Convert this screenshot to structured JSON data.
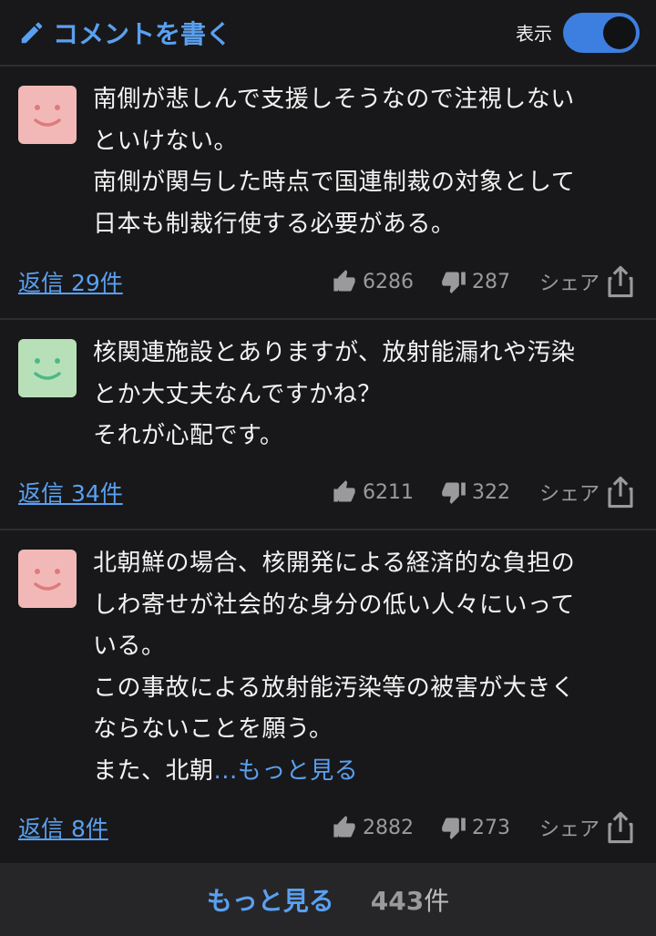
{
  "header": {
    "write_label": "コメントを書く",
    "toggle_label": "表示",
    "toggle_on": true
  },
  "comments": [
    {
      "avatar": "smile-face-pink",
      "lines": [
        "南側が悲しんで支援しそうなので注視しない",
        "といけない。",
        "南側が関与した時点で国連制裁の対象として",
        "日本も制裁行使する必要がある。"
      ],
      "reply": "返信 29件",
      "likes": "6286",
      "dislikes": "287",
      "share": "シェア"
    },
    {
      "avatar": "smile-face-green",
      "lines": [
        "核関連施設とありますが、放射能漏れや汚染",
        "とか大丈夫なんですかね？",
        "それが心配です。"
      ],
      "reply": "返信 34件",
      "likes": "6211",
      "dislikes": "322",
      "share": "シェア"
    },
    {
      "avatar": "smile-face-pink",
      "lines": [
        "北朝鮮の場合、核開発による経済的な負担の",
        "しわ寄せが社会的な身分の低い人々にいって",
        "いる。",
        "この事故による放射能汚染等の被害が大きく",
        "ならないことを願う。"
      ],
      "last_line": "また、北朝",
      "more_inline": "...もっと見る",
      "reply": "返信 8件",
      "likes": "2882",
      "dislikes": "273",
      "share": "シェア"
    }
  ],
  "footer": {
    "more_label": "もっと見る",
    "count_number": "443",
    "count_unit": "件"
  },
  "colors": {
    "accent": "#5aa0f0",
    "avatar_pink": "#f2b8b8",
    "avatar_green": "#b8e0b8"
  }
}
